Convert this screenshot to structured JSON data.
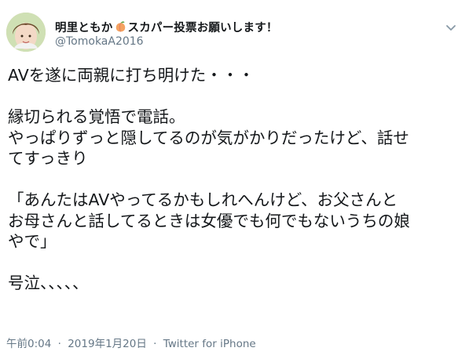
{
  "tweet": {
    "display_name": "明里ともか",
    "display_name_suffix": "スカパー投票お願いします！",
    "handle": "@TomokaA2016",
    "avatar_icon": "profile-photo",
    "menu_icon": "chevron-down-icon",
    "peach_icon": "peach-emoji-icon",
    "text": {
      "line1": "AVを遂に両親に打ち明けた・・・",
      "line2": "縁切られる覚悟で電話。",
      "line3": "やっぱりずっと隠してるのが気がかりだったけど、話せ",
      "line4": "てすっきり",
      "line5": "「あんたはAVやってるかもしれへんけど、お父さんと",
      "line6": "お母さんと話してるときは女優でも何でもないうちの娘",
      "line7": "やで」",
      "line8": "号泣、、、、、"
    },
    "time": "午前0:04",
    "separator": "·",
    "date": "2019年1月20日",
    "source": "Twitter for iPhone"
  },
  "colors": {
    "text": "#14171a",
    "secondary": "#657786",
    "peach": "#f4a261"
  }
}
